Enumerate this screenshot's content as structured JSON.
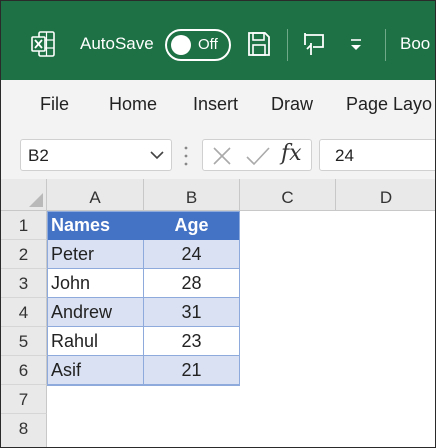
{
  "titlebar": {
    "autosave_label": "AutoSave",
    "toggle_state": "Off",
    "doc_name": "Boo",
    "icons": [
      "excel-icon",
      "save-icon",
      "touch-mode-icon",
      "customize-qat-icon"
    ],
    "colors": {
      "background": "#1e7145",
      "text": "#ffffff"
    }
  },
  "ribbon": {
    "tabs": [
      "File",
      "Home",
      "Insert",
      "Draw",
      "Page Layo"
    ]
  },
  "formula_bar": {
    "name_box": "B2",
    "formula_value": "24",
    "fx_label": "fx"
  },
  "grid": {
    "columns": [
      "A",
      "B",
      "C",
      "D"
    ],
    "rows": [
      "1",
      "2",
      "3",
      "4",
      "5",
      "6",
      "7",
      "8"
    ],
    "table": {
      "headers": [
        "Names",
        "Age"
      ],
      "rows": [
        [
          "Peter",
          "24"
        ],
        [
          "John",
          "28"
        ],
        [
          "Andrew",
          "31"
        ],
        [
          "Rahul",
          "23"
        ],
        [
          "Asif",
          "21"
        ]
      ]
    },
    "colors": {
      "header": "#4472c4",
      "band": "#d9e1f2",
      "border": "#8ea9db"
    }
  }
}
